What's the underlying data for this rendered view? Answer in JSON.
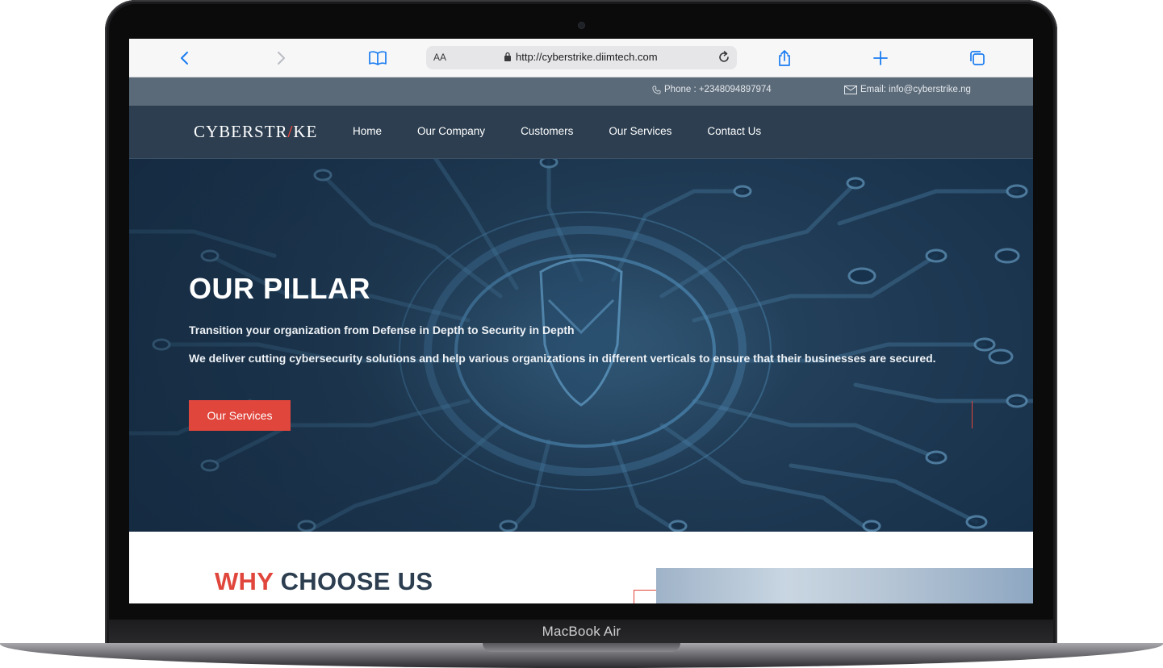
{
  "device": {
    "label": "MacBook Air"
  },
  "browser": {
    "text_size_label": "AA",
    "url": "http://cyberstrike.diimtech.com"
  },
  "topbar": {
    "phone": "Phone : +2348094897974",
    "email": "Email: info@cyberstrike.ng"
  },
  "site": {
    "logo_before": "CYBERSTR",
    "logo_bolt": "/",
    "logo_after": "KE",
    "nav": [
      "Home",
      "Our Company",
      "Customers",
      "Our Services",
      "Contact Us"
    ]
  },
  "hero": {
    "title": "OUR PILLAR",
    "subtitle": "Transition your organization from Defense in Depth to Security in Depth",
    "description": "We deliver cutting cybersecurity solutions and help various organizations in different verticals to ensure that their businesses are secured.",
    "button": "Our Services"
  },
  "why": {
    "accent_word": "WHY",
    "rest": "CHOOSE US"
  },
  "colors": {
    "accent": "#e0463c",
    "navy": "#2c3e50",
    "topbar": "#5b6a78"
  }
}
